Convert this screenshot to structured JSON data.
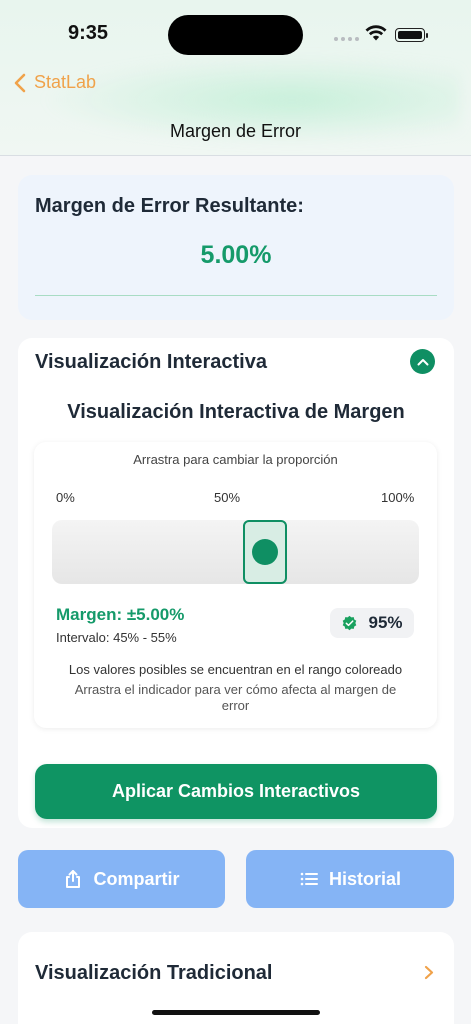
{
  "status_bar": {
    "time": "9:35"
  },
  "nav": {
    "back_label": "StatLab",
    "title": "Margen de Error"
  },
  "result": {
    "title": "Margen de Error Resultante:",
    "value": "5.00%"
  },
  "interactive": {
    "header": "Visualización Interactiva",
    "viz_title": "Visualización Interactiva de Margen",
    "drag_hint": "Arrastra para cambiar la proporción",
    "scale": [
      "0%",
      "50%",
      "100%"
    ],
    "slider_value": 0.58,
    "margin_text": "Margen: ±5.00%",
    "interval_text": "Intervalo: 45% - 55%",
    "confidence": "95%",
    "note_range": "Los valores posibles se encuentran en el rango coloreado",
    "note_drag": "Arrastra el indicador para ver cómo afecta al margen de error",
    "apply_label": "Aplicar Cambios Interactivos"
  },
  "actions": {
    "share_label": "Compartir",
    "history_label": "Historial"
  },
  "traditional": {
    "label": "Visualización Tradicional"
  },
  "colors": {
    "accent": "#0f9463",
    "back": "#f0a24a",
    "pill": "#85b4f5"
  }
}
